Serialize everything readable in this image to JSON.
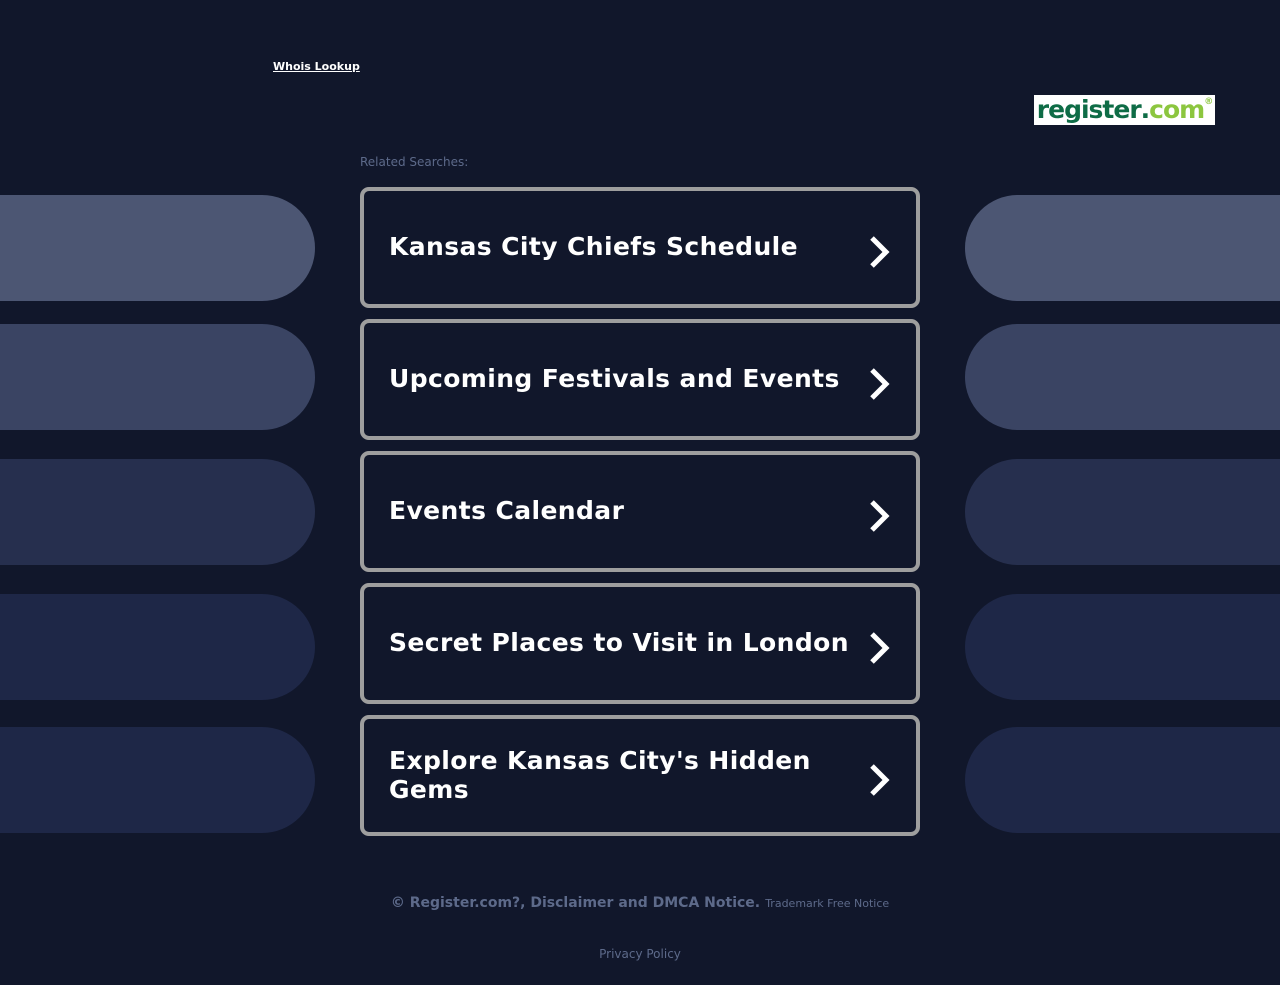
{
  "header": {
    "whois_link": "Whois Lookup",
    "logo": {
      "main": "register",
      "dot": ".",
      "tld": "com",
      "mark": "®"
    }
  },
  "main": {
    "related_label": "Related Searches:",
    "searches": [
      {
        "label": "Kansas City Chiefs Schedule"
      },
      {
        "label": "Upcoming Festivals and Events"
      },
      {
        "label": "Events Calendar"
      },
      {
        "label": "Secret Places to Visit in London"
      },
      {
        "label": "Explore Kansas City's Hidden Gems"
      }
    ]
  },
  "footer": {
    "copyright": "© Register.com?, Disclaimer and DMCA Notice.",
    "trademark": "Trademark Free Notice",
    "privacy": "Privacy Policy"
  },
  "colors": {
    "background": "#11172b",
    "card_border": "#9e9e9e",
    "logo_green": "#0e6c46",
    "logo_lime": "#8cc63f",
    "muted_text": "#5d6a8a"
  },
  "icons": {
    "card_arrow": "chevron-right-icon"
  }
}
